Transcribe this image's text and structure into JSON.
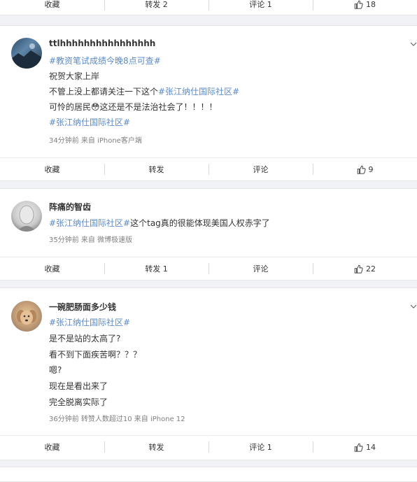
{
  "top_bar": {
    "collect": "收藏",
    "repost": "转发 2",
    "comment": "评论 1",
    "like": "18"
  },
  "posts": [
    {
      "username": "ttlhhhhhhhhhhhhhhhh",
      "tag_line": "#教资笔试成绩今晚8点可查#",
      "line1": "祝贺大家上岸",
      "line2_pre": "不管上没上都请关注一下这个",
      "line2_tag": "#张江纳仕国际社区#",
      "line3_pre": "可怜的居民",
      "line3_emoji": "😳",
      "line3_post": "这还是不是法治社会了！！！！",
      "line4_tag": "#张江纳仕国际社区#",
      "meta": "34分钟前  来自 iPhone客户端",
      "actions": {
        "collect": "收藏",
        "repost": "转发",
        "comment": "评论",
        "like": "9"
      }
    },
    {
      "username": "阵痛的智齿",
      "line1_tag": "#张江纳仕国际社区#",
      "line1_post": "这个tag真的很能体现美国人权赤字了",
      "meta": "35分钟前  来自 微博极速版",
      "actions": {
        "collect": "收藏",
        "repost": "转发 1",
        "comment": "评论",
        "like": "22"
      }
    },
    {
      "username": "一碗肥肠面多少钱",
      "tag_line": "#张江纳仕国际社区#",
      "line1": "是不是站的太高了?",
      "line2": "看不到下面疾苦啊？？？",
      "line3": "嗯?",
      "line4": "现在是看出来了",
      "line5": "完全脱离实际了",
      "meta": "36分钟前 转赞人数超过10  来自 iPhone 12",
      "actions": {
        "collect": "收藏",
        "repost": "转发",
        "comment": "评论 1",
        "like": "14"
      }
    }
  ],
  "colors": {
    "link": "#5b8ac7",
    "background": "#f1f2f5"
  }
}
